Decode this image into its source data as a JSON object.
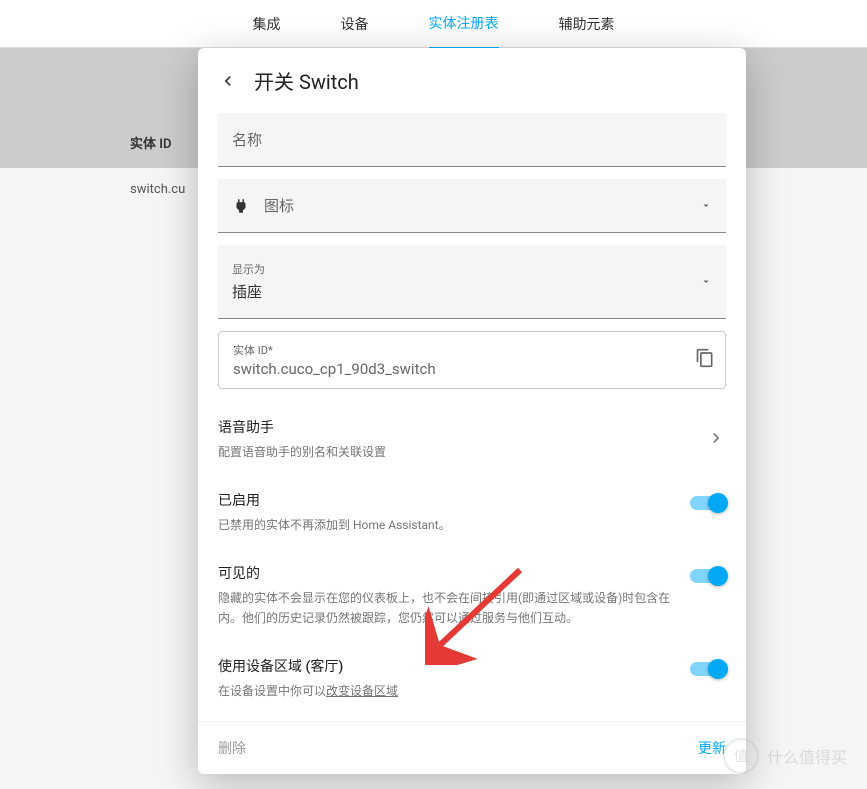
{
  "topbar": {
    "items": [
      {
        "label": "集成"
      },
      {
        "label": "设备"
      },
      {
        "label": "实体注册表",
        "active": true
      },
      {
        "label": "辅助元素"
      }
    ]
  },
  "background": {
    "entity_id_header": "实体 ID",
    "entity_row": "switch.cu"
  },
  "modal": {
    "title": "开关 Switch",
    "name_field": {
      "placeholder": "名称"
    },
    "icon_field": {
      "label": "图标"
    },
    "display_as": {
      "label": "显示为",
      "value": "插座"
    },
    "entity_id": {
      "label": "实体 ID*",
      "value": "switch.cuco_cp1_90d3_switch"
    },
    "voice": {
      "title": "语音助手",
      "desc": "配置语音助手的别名和关联设置"
    },
    "enabled": {
      "title": "已启用",
      "desc": "已禁用的实体不再添加到 Home Assistant。"
    },
    "visible": {
      "title": "可见的",
      "desc": "隐藏的实体不会显示在您的仪表板上，也不会在间接引用(即通过区域或设备)时包含在内。他们的历史记录仍然被跟踪，您仍然可以通过服务与他们互动。"
    },
    "area": {
      "title": "使用设备区域 (客厅)",
      "desc_prefix": "在设备设置中你可以",
      "desc_link": "改变设备区域"
    },
    "footer": {
      "delete": "删除",
      "update": "更新"
    }
  },
  "watermark": {
    "text": "什么值得买",
    "badge": "值"
  }
}
